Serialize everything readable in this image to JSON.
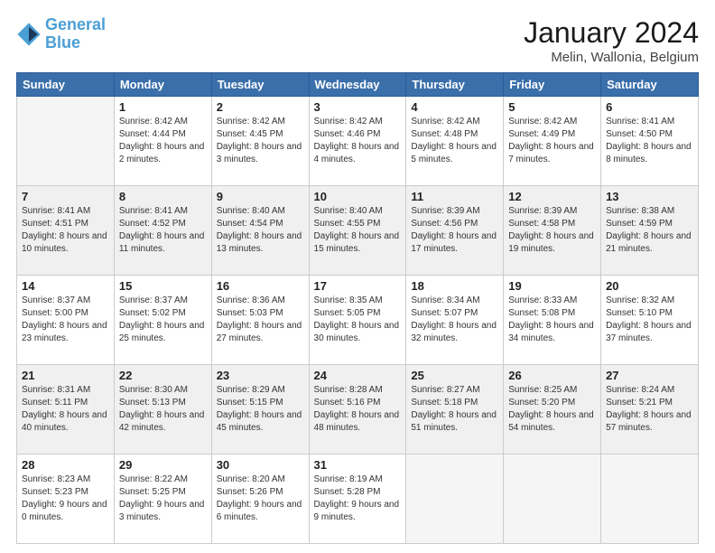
{
  "logo": {
    "line1": "General",
    "line2": "Blue"
  },
  "title": "January 2024",
  "subtitle": "Melin, Wallonia, Belgium",
  "days": [
    "Sunday",
    "Monday",
    "Tuesday",
    "Wednesday",
    "Thursday",
    "Friday",
    "Saturday"
  ],
  "weeks": [
    [
      {
        "num": "",
        "sunrise": "",
        "sunset": "",
        "daylight": ""
      },
      {
        "num": "1",
        "sunrise": "Sunrise: 8:42 AM",
        "sunset": "Sunset: 4:44 PM",
        "daylight": "Daylight: 8 hours and 2 minutes."
      },
      {
        "num": "2",
        "sunrise": "Sunrise: 8:42 AM",
        "sunset": "Sunset: 4:45 PM",
        "daylight": "Daylight: 8 hours and 3 minutes."
      },
      {
        "num": "3",
        "sunrise": "Sunrise: 8:42 AM",
        "sunset": "Sunset: 4:46 PM",
        "daylight": "Daylight: 8 hours and 4 minutes."
      },
      {
        "num": "4",
        "sunrise": "Sunrise: 8:42 AM",
        "sunset": "Sunset: 4:48 PM",
        "daylight": "Daylight: 8 hours and 5 minutes."
      },
      {
        "num": "5",
        "sunrise": "Sunrise: 8:42 AM",
        "sunset": "Sunset: 4:49 PM",
        "daylight": "Daylight: 8 hours and 7 minutes."
      },
      {
        "num": "6",
        "sunrise": "Sunrise: 8:41 AM",
        "sunset": "Sunset: 4:50 PM",
        "daylight": "Daylight: 8 hours and 8 minutes."
      }
    ],
    [
      {
        "num": "7",
        "sunrise": "Sunrise: 8:41 AM",
        "sunset": "Sunset: 4:51 PM",
        "daylight": "Daylight: 8 hours and 10 minutes."
      },
      {
        "num": "8",
        "sunrise": "Sunrise: 8:41 AM",
        "sunset": "Sunset: 4:52 PM",
        "daylight": "Daylight: 8 hours and 11 minutes."
      },
      {
        "num": "9",
        "sunrise": "Sunrise: 8:40 AM",
        "sunset": "Sunset: 4:54 PM",
        "daylight": "Daylight: 8 hours and 13 minutes."
      },
      {
        "num": "10",
        "sunrise": "Sunrise: 8:40 AM",
        "sunset": "Sunset: 4:55 PM",
        "daylight": "Daylight: 8 hours and 15 minutes."
      },
      {
        "num": "11",
        "sunrise": "Sunrise: 8:39 AM",
        "sunset": "Sunset: 4:56 PM",
        "daylight": "Daylight: 8 hours and 17 minutes."
      },
      {
        "num": "12",
        "sunrise": "Sunrise: 8:39 AM",
        "sunset": "Sunset: 4:58 PM",
        "daylight": "Daylight: 8 hours and 19 minutes."
      },
      {
        "num": "13",
        "sunrise": "Sunrise: 8:38 AM",
        "sunset": "Sunset: 4:59 PM",
        "daylight": "Daylight: 8 hours and 21 minutes."
      }
    ],
    [
      {
        "num": "14",
        "sunrise": "Sunrise: 8:37 AM",
        "sunset": "Sunset: 5:00 PM",
        "daylight": "Daylight: 8 hours and 23 minutes."
      },
      {
        "num": "15",
        "sunrise": "Sunrise: 8:37 AM",
        "sunset": "Sunset: 5:02 PM",
        "daylight": "Daylight: 8 hours and 25 minutes."
      },
      {
        "num": "16",
        "sunrise": "Sunrise: 8:36 AM",
        "sunset": "Sunset: 5:03 PM",
        "daylight": "Daylight: 8 hours and 27 minutes."
      },
      {
        "num": "17",
        "sunrise": "Sunrise: 8:35 AM",
        "sunset": "Sunset: 5:05 PM",
        "daylight": "Daylight: 8 hours and 30 minutes."
      },
      {
        "num": "18",
        "sunrise": "Sunrise: 8:34 AM",
        "sunset": "Sunset: 5:07 PM",
        "daylight": "Daylight: 8 hours and 32 minutes."
      },
      {
        "num": "19",
        "sunrise": "Sunrise: 8:33 AM",
        "sunset": "Sunset: 5:08 PM",
        "daylight": "Daylight: 8 hours and 34 minutes."
      },
      {
        "num": "20",
        "sunrise": "Sunrise: 8:32 AM",
        "sunset": "Sunset: 5:10 PM",
        "daylight": "Daylight: 8 hours and 37 minutes."
      }
    ],
    [
      {
        "num": "21",
        "sunrise": "Sunrise: 8:31 AM",
        "sunset": "Sunset: 5:11 PM",
        "daylight": "Daylight: 8 hours and 40 minutes."
      },
      {
        "num": "22",
        "sunrise": "Sunrise: 8:30 AM",
        "sunset": "Sunset: 5:13 PM",
        "daylight": "Daylight: 8 hours and 42 minutes."
      },
      {
        "num": "23",
        "sunrise": "Sunrise: 8:29 AM",
        "sunset": "Sunset: 5:15 PM",
        "daylight": "Daylight: 8 hours and 45 minutes."
      },
      {
        "num": "24",
        "sunrise": "Sunrise: 8:28 AM",
        "sunset": "Sunset: 5:16 PM",
        "daylight": "Daylight: 8 hours and 48 minutes."
      },
      {
        "num": "25",
        "sunrise": "Sunrise: 8:27 AM",
        "sunset": "Sunset: 5:18 PM",
        "daylight": "Daylight: 8 hours and 51 minutes."
      },
      {
        "num": "26",
        "sunrise": "Sunrise: 8:25 AM",
        "sunset": "Sunset: 5:20 PM",
        "daylight": "Daylight: 8 hours and 54 minutes."
      },
      {
        "num": "27",
        "sunrise": "Sunrise: 8:24 AM",
        "sunset": "Sunset: 5:21 PM",
        "daylight": "Daylight: 8 hours and 57 minutes."
      }
    ],
    [
      {
        "num": "28",
        "sunrise": "Sunrise: 8:23 AM",
        "sunset": "Sunset: 5:23 PM",
        "daylight": "Daylight: 9 hours and 0 minutes."
      },
      {
        "num": "29",
        "sunrise": "Sunrise: 8:22 AM",
        "sunset": "Sunset: 5:25 PM",
        "daylight": "Daylight: 9 hours and 3 minutes."
      },
      {
        "num": "30",
        "sunrise": "Sunrise: 8:20 AM",
        "sunset": "Sunset: 5:26 PM",
        "daylight": "Daylight: 9 hours and 6 minutes."
      },
      {
        "num": "31",
        "sunrise": "Sunrise: 8:19 AM",
        "sunset": "Sunset: 5:28 PM",
        "daylight": "Daylight: 9 hours and 9 minutes."
      },
      {
        "num": "",
        "sunrise": "",
        "sunset": "",
        "daylight": ""
      },
      {
        "num": "",
        "sunrise": "",
        "sunset": "",
        "daylight": ""
      },
      {
        "num": "",
        "sunrise": "",
        "sunset": "",
        "daylight": ""
      }
    ]
  ]
}
